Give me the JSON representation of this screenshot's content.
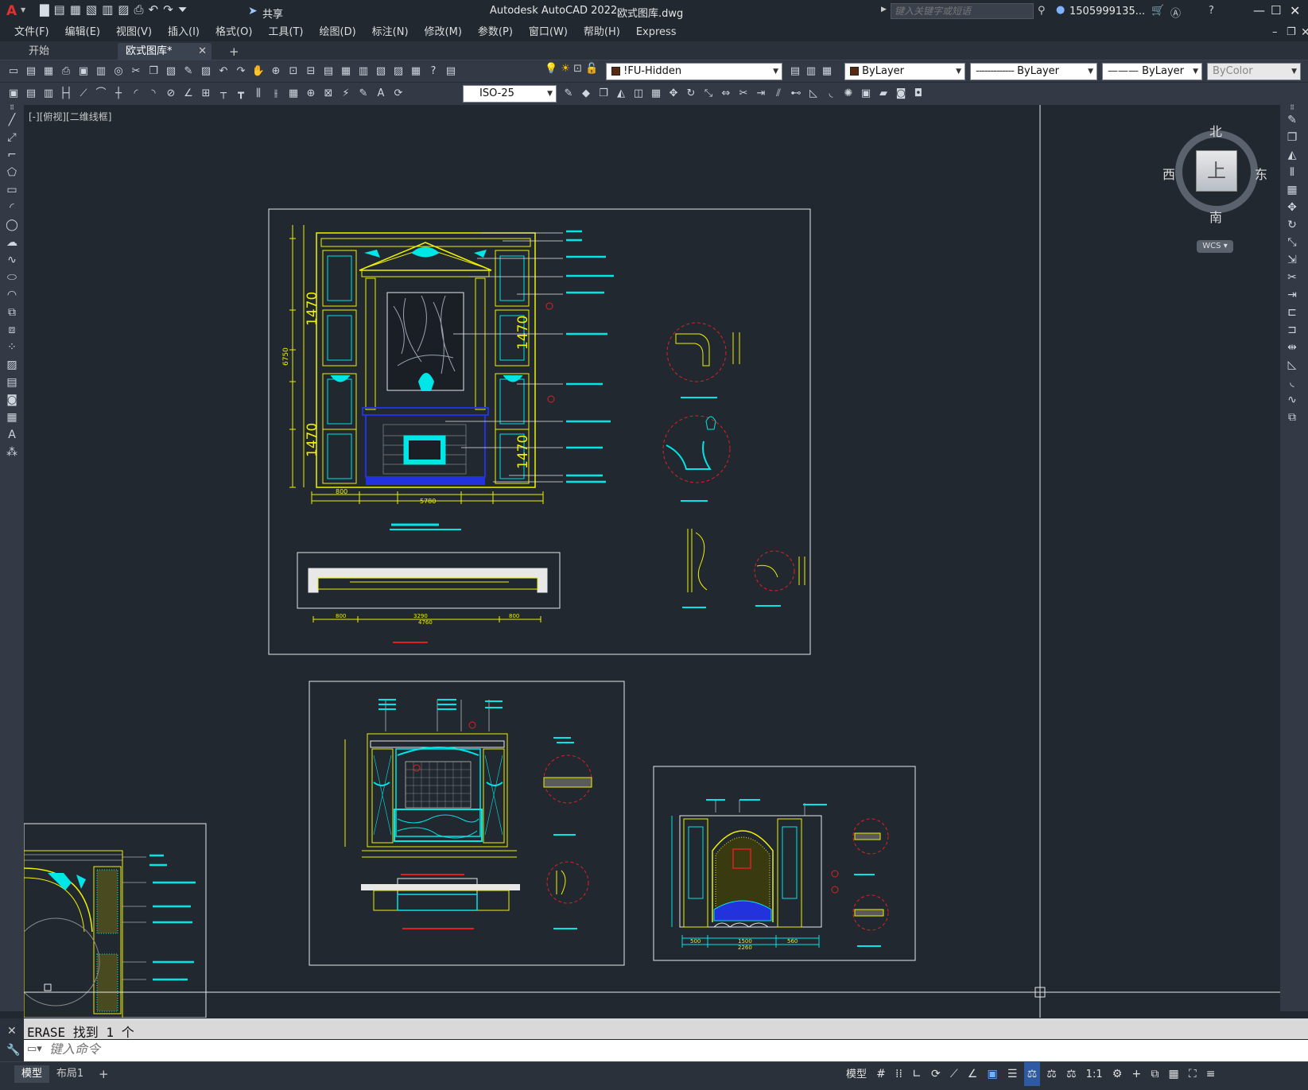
{
  "app": {
    "title": "Autodesk AutoCAD 2022",
    "filename": "欧式图库.dwg",
    "share_label": "共享",
    "search_placeholder": "键入关键字或短语",
    "user": "1505999135..."
  },
  "menu": [
    "文件(F)",
    "编辑(E)",
    "视图(V)",
    "插入(I)",
    "格式(O)",
    "工具(T)",
    "绘图(D)",
    "标注(N)",
    "修改(M)",
    "参数(P)",
    "窗口(W)",
    "帮助(H)",
    "Express"
  ],
  "tabs": {
    "start": "开始",
    "active": "欧式图库*"
  },
  "toolbar": {
    "layer": "!FU-Hidden",
    "color": "ByLayer",
    "linetype": "ByLayer",
    "lineweight": "ByLayer",
    "plotstyle": "ByColor",
    "dimstyle": "ISO-25"
  },
  "viewport": {
    "label": "[-][俯视][二维线框]"
  },
  "viewcube": {
    "north": "北",
    "south": "南",
    "east": "东",
    "west": "西",
    "top": "上",
    "wcs": "WCS"
  },
  "drawing": {
    "dim_1470": "1470",
    "dim_6750": "6750",
    "dim_total": "5780",
    "dim_3290": "3290",
    "dim_4760": "4760",
    "dim_800": "800",
    "dim_880": "880",
    "dim_2260": "2260",
    "dim_1500": "1500",
    "dim_560": "560",
    "dim_500": "500"
  },
  "command": {
    "history": "ERASE 找到 1 个",
    "placeholder": "键入命令"
  },
  "layout_tabs": [
    "模型",
    "布局1"
  ],
  "status": {
    "model": "模型",
    "scale": "1:1"
  },
  "colors": {
    "bg": "#212830",
    "yellow": "#f0f000",
    "cyan": "#00e5e5",
    "blue": "#2233dd",
    "red": "#e02020",
    "white": "#e8e8e8"
  }
}
